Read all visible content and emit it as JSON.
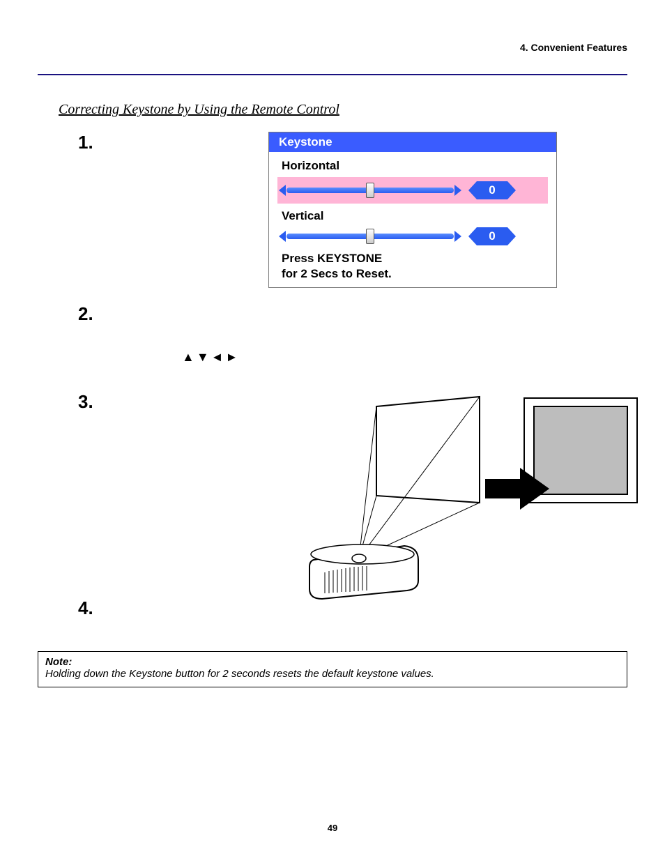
{
  "header": {
    "section_label": "4. Convenient Features"
  },
  "title": "Correcting Keystone by Using the Remote Control",
  "steps": {
    "s1": "1.",
    "s2": "2.",
    "s3": "3.",
    "s4": "4."
  },
  "arrows_glyph": "▲▼◄►",
  "keystone": {
    "title": "Keystone",
    "horizontal_label": "Horizontal",
    "horizontal_value": "0",
    "vertical_label": "Vertical",
    "vertical_value": "0",
    "reset_line1": "Press KEYSTONE",
    "reset_line2": "for 2 Secs to Reset."
  },
  "note": {
    "label": "Note:",
    "text": "Holding down the Keystone button for 2 seconds resets the default keystone values."
  },
  "page_number": "49"
}
